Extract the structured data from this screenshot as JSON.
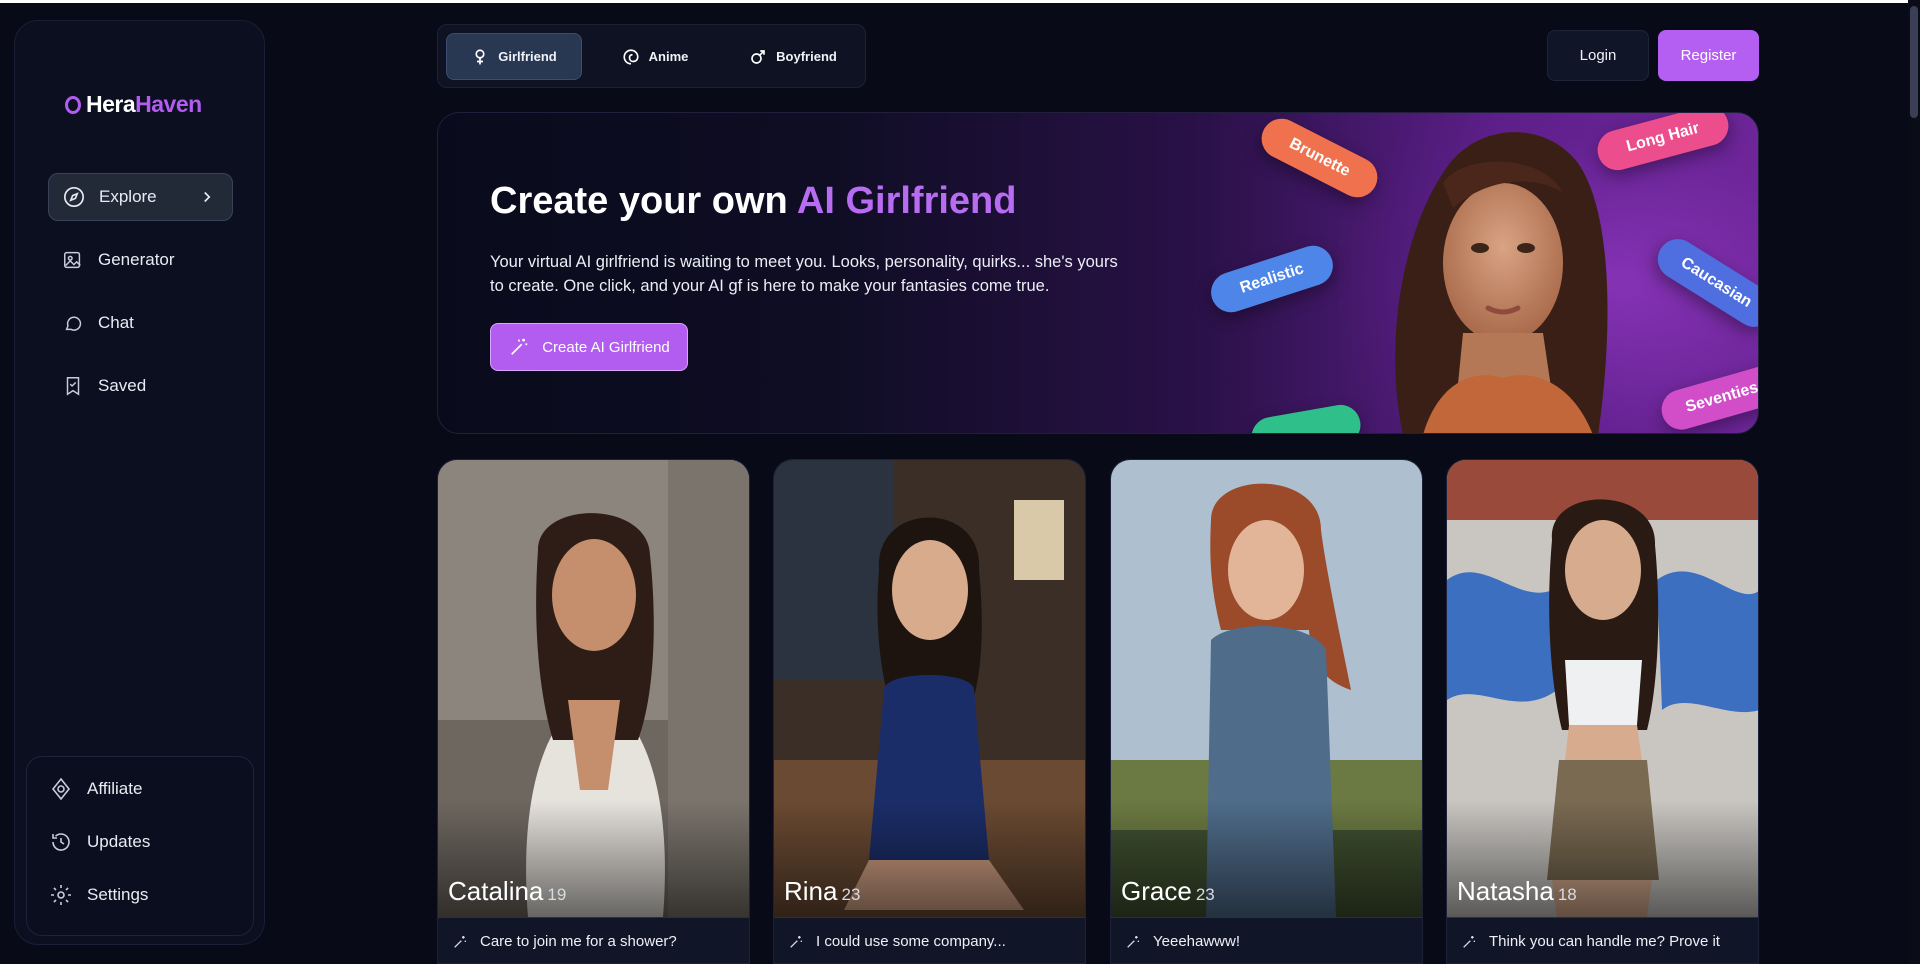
{
  "brand": {
    "part1": "Hera",
    "part2": "Haven"
  },
  "sidebar": {
    "nav": [
      {
        "label": "Explore",
        "icon": "compass-icon",
        "active": true
      },
      {
        "label": "Generator",
        "icon": "image-gallery-icon"
      },
      {
        "label": "Chat",
        "icon": "chat-bubble-icon"
      },
      {
        "label": "Saved",
        "icon": "bookmark-icon"
      }
    ],
    "bottom": [
      {
        "label": "Affiliate",
        "icon": "affiliate-icon"
      },
      {
        "label": "Updates",
        "icon": "history-icon"
      },
      {
        "label": "Settings",
        "icon": "gear-icon"
      }
    ]
  },
  "tabs": [
    {
      "label": "Girlfriend",
      "icon": "female-symbol-icon",
      "active": true
    },
    {
      "label": "Anime",
      "icon": "swirl-icon"
    },
    {
      "label": "Boyfriend",
      "icon": "male-symbol-icon"
    }
  ],
  "auth": {
    "login": "Login",
    "register": "Register"
  },
  "hero": {
    "title_prefix": "Create your own",
    "title_accent": "AI Girlfriend",
    "description": "Your virtual AI girlfriend is waiting to meet you. Looks, personality, quirks... she's yours to create. One click, and your AI gf is here to make your fantasies come true.",
    "cta": "Create AI Girlfriend",
    "tags": [
      "Brunette",
      "Long Hair",
      "Realistic",
      "Caucasian",
      "Seventies"
    ]
  },
  "characters": [
    {
      "name": "Catalina",
      "age": "19",
      "message": "Care to join me for a shower?"
    },
    {
      "name": "Rina",
      "age": "23",
      "message": "I could use some company..."
    },
    {
      "name": "Grace",
      "age": "23",
      "message": "Yeeehawww!"
    },
    {
      "name": "Natasha",
      "age": "18",
      "message": "Think you can handle me? Prove it"
    }
  ],
  "colors": {
    "accent": "#b45ef2",
    "background": "#080a18",
    "panel": "#0c0f20"
  }
}
